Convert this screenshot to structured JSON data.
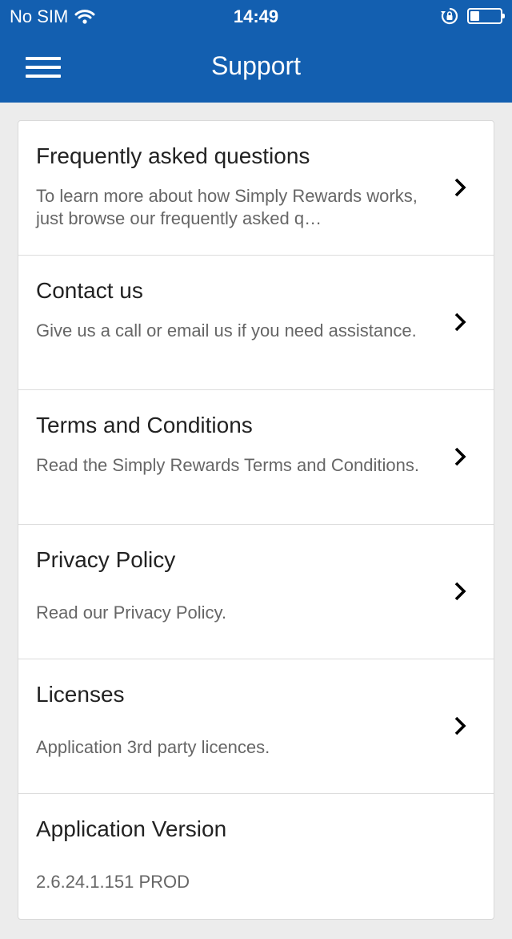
{
  "status_bar": {
    "carrier": "No SIM",
    "time": "14:49",
    "battery_level": 0.3,
    "icons": [
      "wifi-icon",
      "rotation-lock-icon",
      "battery-icon"
    ]
  },
  "nav": {
    "title": "Support",
    "menu_icon": "hamburger-menu-icon"
  },
  "items": [
    {
      "title": "Frequently asked questions",
      "description": "To learn more about how Simply Rewards works, just browse our frequently asked q…"
    },
    {
      "title": "Contact us",
      "description": "Give us a call or email us if you need assistance."
    },
    {
      "title": "Terms and Conditions",
      "description": "Read the Simply Rewards Terms and Conditions."
    },
    {
      "title": "Privacy Policy",
      "description": "Read our Privacy Policy."
    },
    {
      "title": "Licenses",
      "description": "Application 3rd party licences."
    }
  ],
  "version": {
    "title": "Application Version",
    "value": "2.6.24.1.151 PROD"
  },
  "colors": {
    "header": "#135fb0",
    "background": "#ececec"
  }
}
